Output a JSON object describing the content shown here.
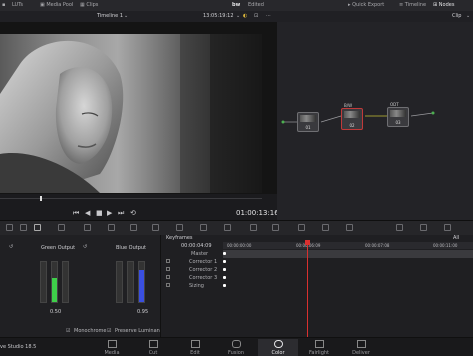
{
  "topbar": {
    "luts": "LUTs",
    "media_pool": "Media Pool",
    "clips": "Clips",
    "timeline": "Timeline 1",
    "timecode": "13:05:19:12",
    "project": "bw",
    "status": "Edited",
    "quick_export": "Quick Export",
    "timeline_btn": "Timeline",
    "nodes_btn": "Nodes"
  },
  "viewer": {
    "timecode": "01:00:13:16"
  },
  "node_editor": {
    "mode": "Clip",
    "nodes": [
      {
        "num": "01",
        "title": ""
      },
      {
        "num": "02",
        "title": "B/W"
      },
      {
        "num": "03",
        "title": "ODT"
      }
    ]
  },
  "scopes": {
    "green": {
      "title": "Green Output",
      "value": "0.50"
    },
    "blue": {
      "title": "Blue Output",
      "value": "0.95"
    },
    "monochrome": "Monochrome",
    "preserve_luminance": "Preserve Luminance"
  },
  "keyframes": {
    "title": "Keyframes",
    "filter": "All",
    "timecode": "00:00:04:09",
    "ruler": [
      "00:00:00:00",
      "00:00:06:09",
      "00:00:07:08",
      "00:00:11:00"
    ],
    "rows": [
      "Master",
      "Corrector 1",
      "Corrector 2",
      "Corrector 3",
      "Sizing"
    ]
  },
  "bottom_nav": {
    "app": "ve Studio 18.5",
    "items": [
      "Media",
      "Cut",
      "Edit",
      "Fusion",
      "Color",
      "Fairlight",
      "Deliver"
    ],
    "active": "Color"
  }
}
